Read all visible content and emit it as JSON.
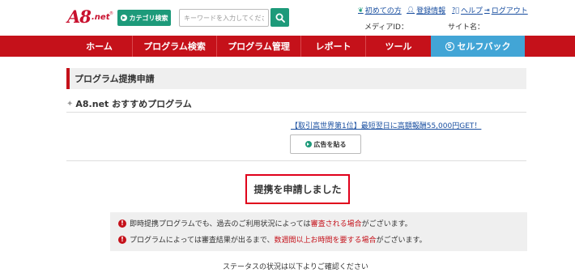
{
  "header": {
    "logo_a8": "A8",
    "logo_net": ".net",
    "logo_reg": "®",
    "category_button": "カテゴリ検索",
    "search_placeholder": "キーワードを入力してください",
    "util_links": [
      {
        "icon": "beginner-mark-icon",
        "label": "初めての方"
      },
      {
        "icon": "person-icon",
        "label": "登録情報"
      },
      {
        "icon": "help-icon",
        "label": "ヘルプ"
      },
      {
        "icon": "logout-icon",
        "label": "ログアウト"
      }
    ],
    "media_id_label": "メディアID：",
    "site_name_label": "サイト名："
  },
  "nav": {
    "items": [
      "ホーム",
      "プログラム検索",
      "プログラム管理",
      "レポート",
      "ツール"
    ],
    "self_back": "セルフバック",
    "self_back_icon": "S"
  },
  "main": {
    "heading": "プログラム提携申請",
    "recommend_title": "A8.net おすすめプログラム",
    "recommend_spark": "✦",
    "ad_link": "【取引高世界第1位】最短翌日に高額報酬55,000円GET！",
    "ad_button": "広告を貼る",
    "completion_message": "提携を申請しました",
    "notice": {
      "line1_before": "即時提携プログラムでも、過去のご利用状況によっては",
      "line1_red": "審査される場合",
      "line1_after": "がございます。",
      "line2_before": "プログラムによっては審査結果が出るまで、",
      "line2_red": "数週間以上お時間を要する場合",
      "line2_after": "がございます。",
      "icon": "!"
    },
    "status_text": "ステータスの状況は以下よりご確認ください"
  },
  "colors": {
    "brand_red": "#c5111a",
    "green": "#1d9a7a",
    "selfback_blue": "#42a5d6",
    "link_blue": "#1a4fa0"
  }
}
